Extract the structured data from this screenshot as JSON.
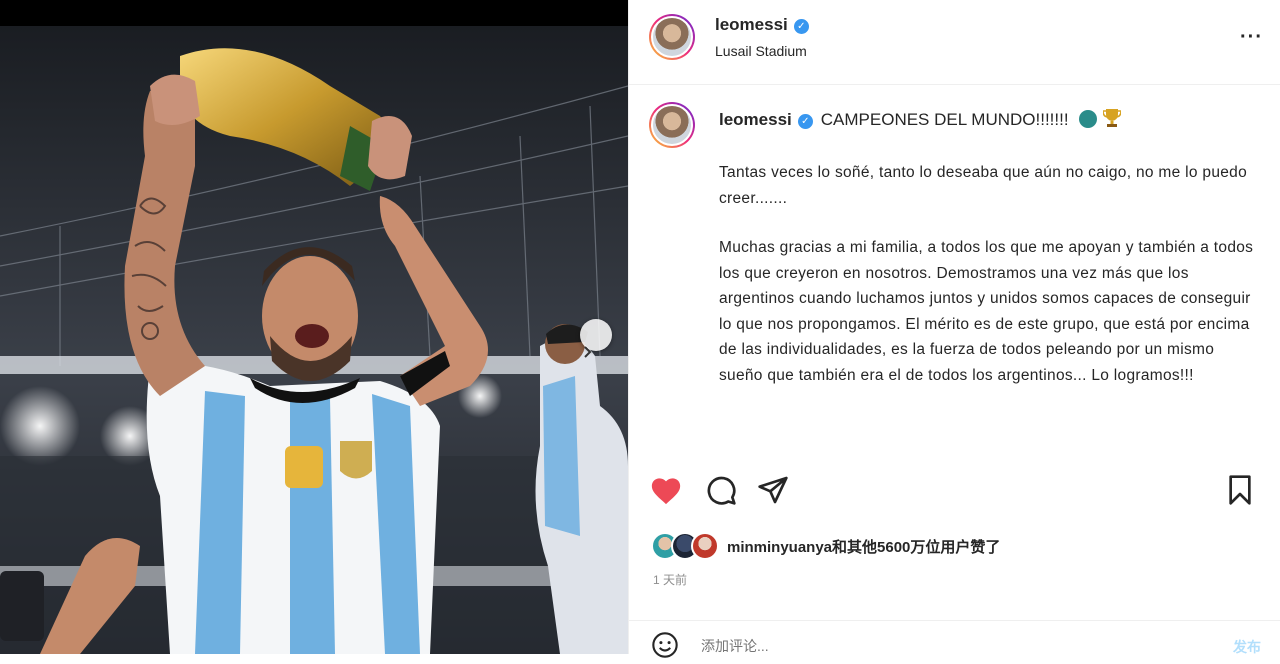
{
  "post": {
    "username": "leomessi",
    "location": "Lusail Stadium",
    "more_label": "···",
    "image_alt": "Player lifting trophy in stadium",
    "carousel_next_icon": "chevron-right-icon"
  },
  "caption": {
    "username": "leomessi",
    "title": "CAMPEONES DEL MUNDO!!!!!!!",
    "paragraphs": [
      "Tantas veces lo soñé, tanto lo deseaba que aún no caigo, no me lo puedo creer.......",
      "Muchas gracias a mi familia, a todos los que me apoyan y también a todos los que creyeron en nosotros. Demostramos una vez más que los argentinos cuando luchamos juntos y unidos somos capaces de conseguir lo que nos propongamos. El mérito es de este grupo, que está por encima de las individualidades, es la fuerza de todos peleando por un mismo sueño que también era el de todos los argentinos... Lo logramos!!!"
    ]
  },
  "actions": {
    "like_icon": "heart-icon",
    "comment_icon": "comment-icon",
    "share_icon": "send-icon",
    "save_icon": "bookmark-icon",
    "liked": true
  },
  "likes": {
    "text": "minminyuanya和其他5600万位用户赞了"
  },
  "timestamp": "1 天前",
  "comment": {
    "placeholder": "添加评论...",
    "post_label": "发布"
  },
  "colors": {
    "like_red": "#ed4956",
    "verified_blue": "#3897f0",
    "post_disabled": "#b2dffc",
    "secondary_text": "#8e8e8e"
  }
}
